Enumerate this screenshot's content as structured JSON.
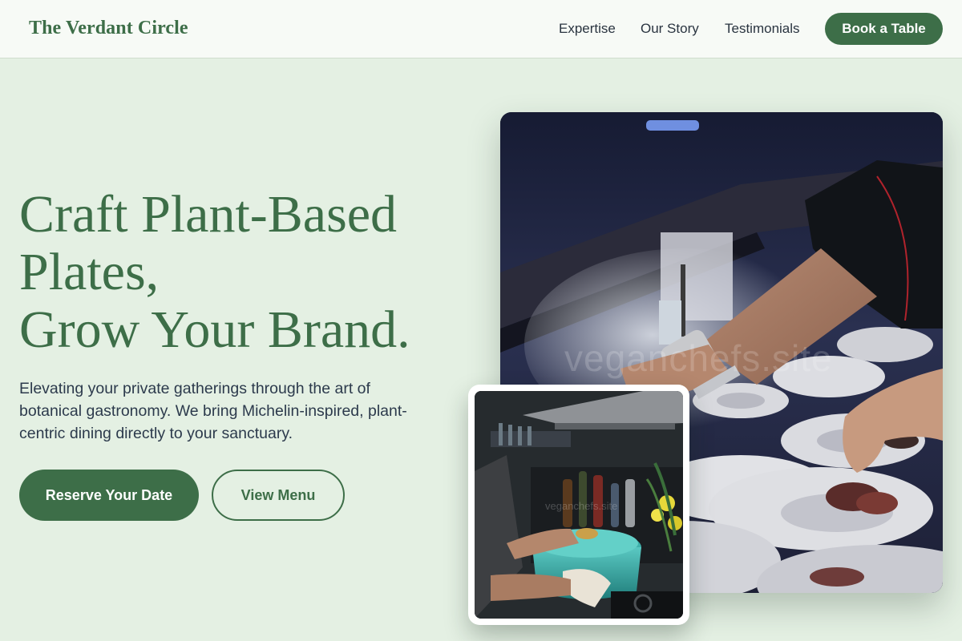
{
  "header": {
    "brand": "The Verdant Circle",
    "nav": [
      "Expertise",
      "Our Story",
      "Testimonials"
    ],
    "cta": "Book a Table"
  },
  "hero": {
    "title_lines": [
      "Craft Plant-Based",
      "Plates,",
      "Grow Your Brand."
    ],
    "subtitle": "Elevating your private gatherings through the art of botanical gastronomy. We bring Michelin-inspired, plant-centric dining directly to your sanctuary.",
    "primary_button": "Reserve Your Date",
    "secondary_button": "View Menu"
  },
  "images": {
    "main_watermark": "veganchefs.site",
    "inset_watermark": "veganchefs.site"
  },
  "colors": {
    "brand_green": "#3d6e48",
    "page_background": "#e4f0e3",
    "header_background": "#f7faf6",
    "body_text": "#2c3a4c"
  }
}
